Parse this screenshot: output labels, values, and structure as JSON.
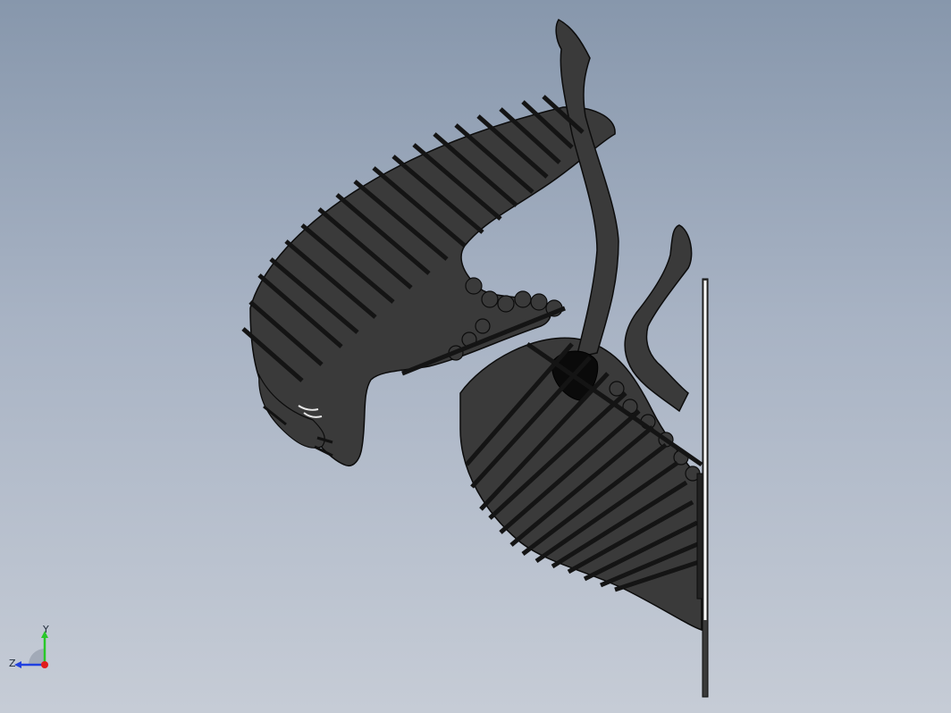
{
  "viewport": {
    "background_top": "#8797ac",
    "background_bottom": "#c6ccd6"
  },
  "model": {
    "body_color": "#3b3b3b",
    "slat_color": "#161616",
    "edge_color": "#0c0c0c",
    "highlight_color": "#ffffff"
  },
  "triad": {
    "y_label": "Y",
    "z_label": "Z",
    "y_color": "#28c828",
    "z_color": "#2040e0",
    "x_color": "#e01c1c"
  }
}
